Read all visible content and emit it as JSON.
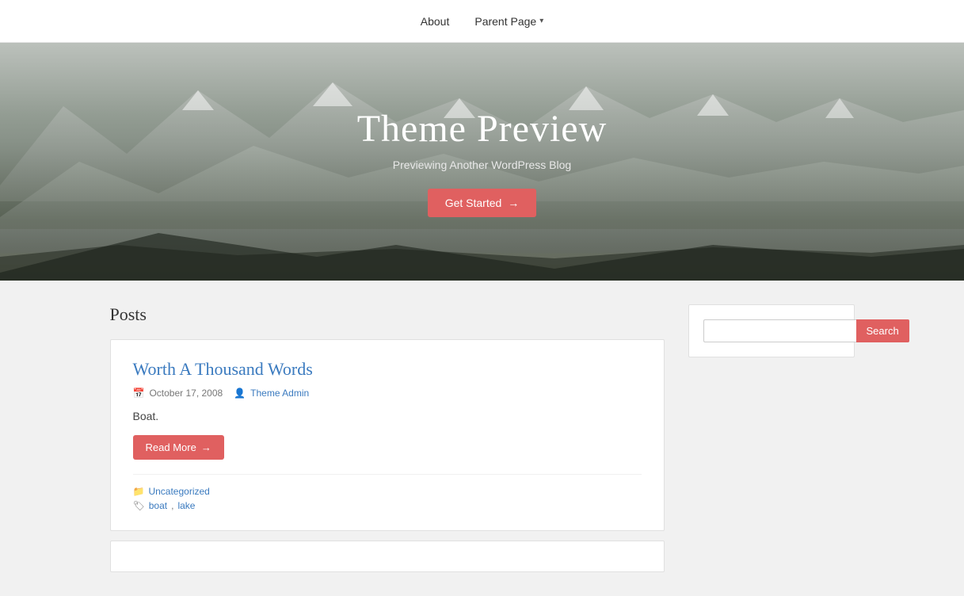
{
  "nav": {
    "items": [
      {
        "label": "About",
        "url": "#",
        "has_dropdown": false
      },
      {
        "label": "Parent Page",
        "url": "#",
        "has_dropdown": true
      }
    ]
  },
  "hero": {
    "title": "Theme Preview",
    "subtitle": "Previewing Another WordPress Blog",
    "cta_label": "Get Started",
    "cta_arrow": "→"
  },
  "posts_section": {
    "heading": "Posts",
    "posts": [
      {
        "title": "Worth A Thousand Words",
        "date": "October 17, 2008",
        "author": "Theme Admin",
        "excerpt": "Boat.",
        "read_more_label": "Read More",
        "read_more_arrow": "→",
        "category": "Uncategorized",
        "tags": [
          "boat",
          "lake"
        ]
      }
    ]
  },
  "sidebar": {
    "search": {
      "placeholder": "",
      "button_label": "Search"
    }
  },
  "icons": {
    "calendar": "📅",
    "author": "👤",
    "folder": "🗂",
    "tag": "🏷",
    "dropdown_arrow": "▾"
  }
}
